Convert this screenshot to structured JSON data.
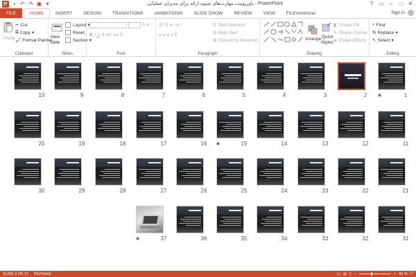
{
  "titlebar": {
    "title": "پاورپوینت مهارت‌های شیوه ارائه برای مدیران عملیاتی - PowerPoint",
    "qat_icons": [
      "save-icon",
      "undo-icon",
      "redo-icon",
      "start-slideshow-icon",
      "customize-icon"
    ]
  },
  "tabs": {
    "file": "FILE",
    "items": [
      "HOME",
      "INSERT",
      "DESIGN",
      "TRANSITIONS",
      "ANIMATIONS",
      "SLIDE SHOW",
      "REVIEW",
      "VIEW",
      "FILEminimizer"
    ],
    "active": "HOME",
    "sign_in": "Sign in"
  },
  "ribbon": {
    "clipboard": {
      "label": "Clipboard",
      "paste": "Paste",
      "cut": "Cut",
      "copy": "Copy",
      "format_painter": "Format Painter"
    },
    "slides": {
      "label": "Slides",
      "new_slide": "New",
      "new_slide2": "Slide",
      "layout": "Layout",
      "reset": "Reset",
      "section": "Section"
    },
    "font": {
      "label": "Font"
    },
    "paragraph": {
      "label": "Paragraph",
      "text_direction": "Text Direction",
      "align_text": "Align Text",
      "convert_smartart": "Convert to SmartArt"
    },
    "drawing": {
      "label": "Drawing",
      "arrange": "Arrange",
      "quick_styles": "Quick",
      "quick_styles2": "Styles",
      "shape_fill": "Shape Fill",
      "shape_outline": "Shape Outline",
      "shape_effects": "Shape Effects"
    },
    "editing": {
      "label": "Editing",
      "find": "Find",
      "replace": "Replace",
      "select": "Select"
    }
  },
  "slides": [
    {
      "num": "1",
      "star": true
    },
    {
      "num": "2",
      "selected": true
    },
    {
      "num": "3"
    },
    {
      "num": "4"
    },
    {
      "num": "5"
    },
    {
      "num": "6"
    },
    {
      "num": "7"
    },
    {
      "num": "8"
    },
    {
      "num": "9"
    },
    {
      "num": "10"
    },
    {
      "num": "11"
    },
    {
      "num": "12"
    },
    {
      "num": "13"
    },
    {
      "num": "14"
    },
    {
      "num": "15",
      "star": true
    },
    {
      "num": "16"
    },
    {
      "num": "17"
    },
    {
      "num": "18"
    },
    {
      "num": "19"
    },
    {
      "num": "20"
    },
    {
      "num": "21"
    },
    {
      "num": "22"
    },
    {
      "num": "23"
    },
    {
      "num": "24"
    },
    {
      "num": "25"
    },
    {
      "num": "26"
    },
    {
      "num": "27"
    },
    {
      "num": "28"
    },
    {
      "num": "29"
    },
    {
      "num": "30"
    },
    {
      "num": "31"
    },
    {
      "num": "32"
    },
    {
      "num": "33"
    },
    {
      "num": "34"
    },
    {
      "num": "35"
    },
    {
      "num": "36"
    },
    {
      "num": "37",
      "star": true,
      "photo": true
    }
  ],
  "status": {
    "slide_of": "SLIDE 2 OF 37",
    "language": "PERSIAN",
    "zoom": "40 %",
    "zoom_fraction": 0.4
  },
  "colors": {
    "accent": "#d24726"
  }
}
